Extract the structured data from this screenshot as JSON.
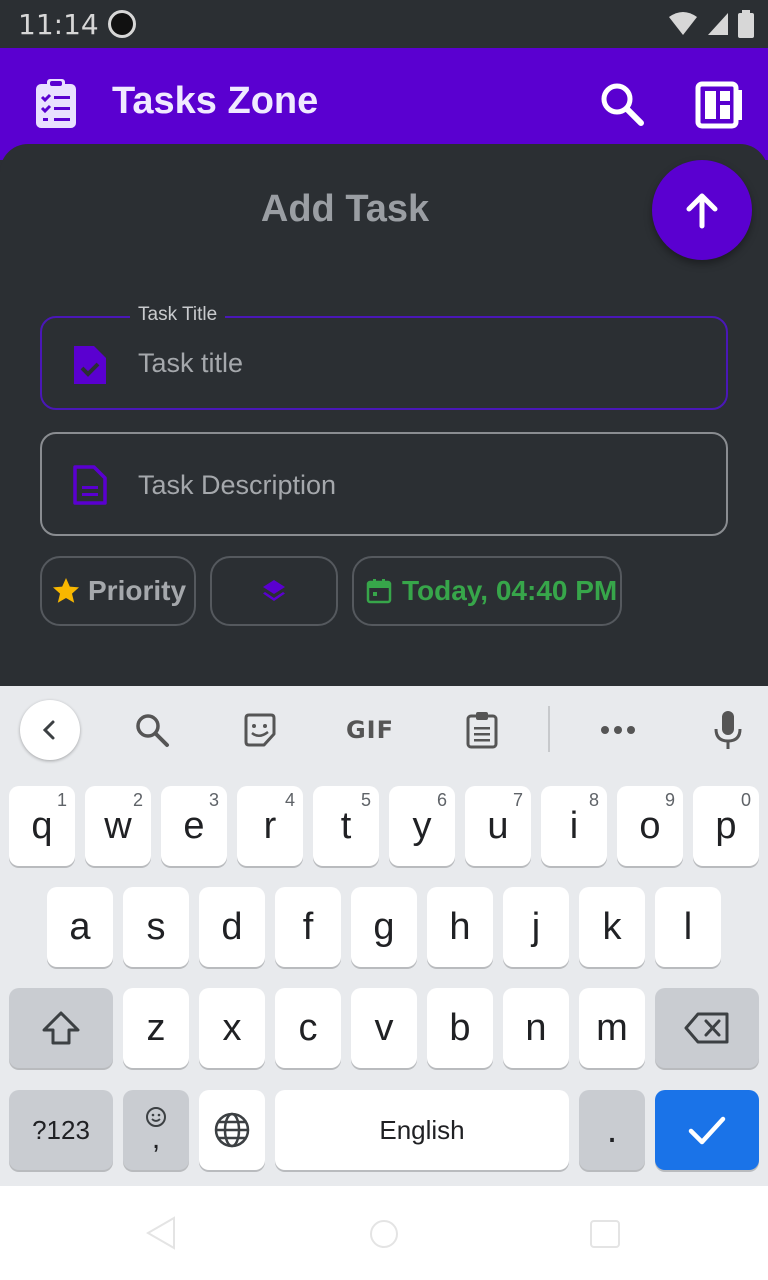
{
  "status": {
    "time": "11:14"
  },
  "app_bar": {
    "title": "Tasks Zone",
    "logo_icon": "clipboard-list-icon",
    "search_icon": "search-icon",
    "view_icon": "dashboard-icon",
    "color": "#5a00d0"
  },
  "sheet": {
    "title": "Add Task",
    "fab_icon": "arrow-up-icon",
    "task_title": {
      "label": "Task Title",
      "placeholder": "Task title",
      "icon": "file-check-icon"
    },
    "task_description": {
      "placeholder": "Task Description",
      "icon": "file-text-icon"
    },
    "chips": {
      "priority": {
        "label": "Priority",
        "icon": "star-icon"
      },
      "category": {
        "icon": "layers-icon"
      },
      "date": {
        "label": "Today, 04:40 PM",
        "icon": "calendar-icon",
        "color": "#37a64a"
      }
    }
  },
  "keyboard": {
    "row1": [
      {
        "k": "q",
        "h": "1"
      },
      {
        "k": "w",
        "h": "2"
      },
      {
        "k": "e",
        "h": "3"
      },
      {
        "k": "r",
        "h": "4"
      },
      {
        "k": "t",
        "h": "5"
      },
      {
        "k": "y",
        "h": "6"
      },
      {
        "k": "u",
        "h": "7"
      },
      {
        "k": "i",
        "h": "8"
      },
      {
        "k": "o",
        "h": "9"
      },
      {
        "k": "p",
        "h": "0"
      }
    ],
    "row2": [
      "a",
      "s",
      "d",
      "f",
      "g",
      "h",
      "j",
      "k",
      "l"
    ],
    "row3": [
      "z",
      "x",
      "c",
      "v",
      "b",
      "n",
      "m"
    ],
    "symbols": "?123",
    "comma": ",",
    "space": "English",
    "period": ".",
    "gif": "GIF"
  }
}
